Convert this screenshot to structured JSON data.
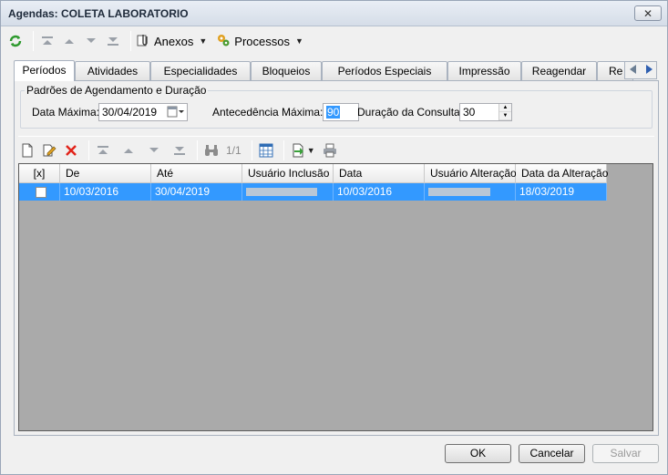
{
  "window": {
    "title": "Agendas: COLETA LABORATORIO",
    "close_label": "✕"
  },
  "toolbar": {
    "anexos_label": "Anexos",
    "processos_label": "Processos"
  },
  "tabs": [
    {
      "label": "Períodos"
    },
    {
      "label": "Atividades"
    },
    {
      "label": "Especialidades"
    },
    {
      "label": "Bloqueios"
    },
    {
      "label": "Períodos Especiais"
    },
    {
      "label": "Impressão"
    },
    {
      "label": "Reagendar"
    },
    {
      "label": "Re"
    }
  ],
  "group": {
    "title": "Padrões de Agendamento e Duração",
    "data_maxima_label": "Data Máxima:",
    "data_maxima_value": "30/04/2019",
    "antecedencia_label": "Antecedência  Máxima:",
    "antecedencia_value": "90",
    "duracao_label": "Duração da Consulta:",
    "duracao_value": "30"
  },
  "gridbar": {
    "page_text": "1/1"
  },
  "grid": {
    "columns": [
      "[x]",
      "De",
      "Até",
      "Usuário Inclusão",
      "Data",
      "Usuário Alteração",
      "Data da Alteração"
    ],
    "rows": [
      {
        "de": "10/03/2016",
        "ate": "30/04/2019",
        "data": "10/03/2016",
        "data_alteracao": "18/03/2019"
      }
    ]
  },
  "buttons": {
    "ok": "OK",
    "cancelar": "Cancelar",
    "salvar": "Salvar"
  }
}
